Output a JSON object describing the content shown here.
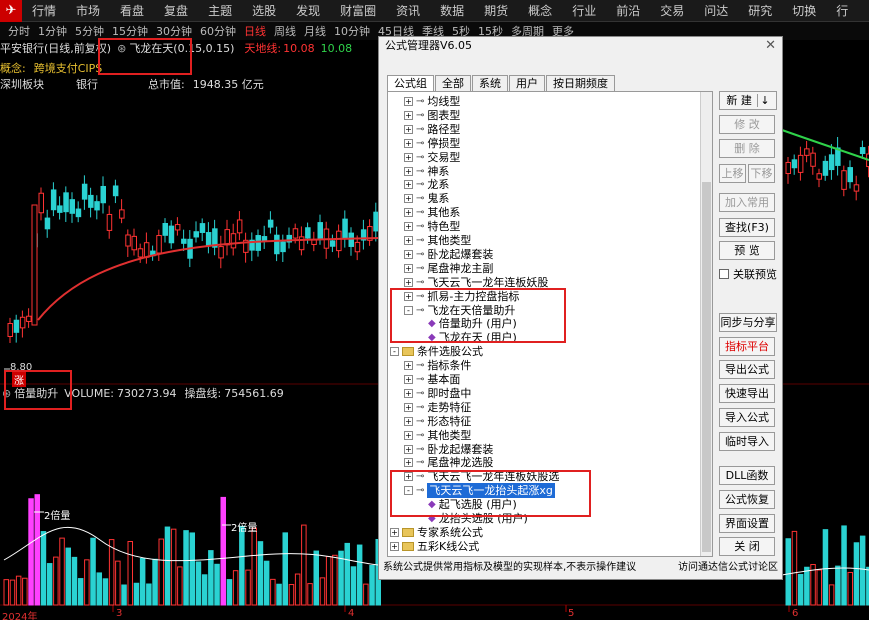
{
  "top_menu": [
    "行情",
    "市场",
    "看盘",
    "复盘",
    "主题",
    "选股",
    "发现",
    "财富圈",
    "资讯",
    "数据",
    "期货",
    "概念",
    "行业",
    "前沿",
    "交易",
    "问达",
    "研究",
    "切换",
    "行"
  ],
  "periods": [
    {
      "label": "分时",
      "active": false
    },
    {
      "label": "1分钟",
      "active": false
    },
    {
      "label": "5分钟",
      "active": false
    },
    {
      "label": "15分钟",
      "active": false
    },
    {
      "label": "30分钟",
      "active": false
    },
    {
      "label": "60分钟",
      "active": false
    },
    {
      "label": "日线",
      "active": true
    },
    {
      "label": "周线",
      "active": false
    },
    {
      "label": "月线",
      "active": false
    },
    {
      "label": "10分钟",
      "active": false
    },
    {
      "label": "45日线",
      "active": false
    },
    {
      "label": "季线",
      "active": false
    },
    {
      "label": "5秒",
      "active": false
    },
    {
      "label": "15秒",
      "active": false
    },
    {
      "label": "多周期",
      "active": false
    },
    {
      "label": "更多",
      "active": false
    }
  ],
  "stock": {
    "name_line": "平安银行(日线,前复权)",
    "indicator": "飞龙在天(0.15,0.15)",
    "tiandi_label": "天地线:",
    "tiandi_v1": "10.08",
    "tiandi_v2": "10.08",
    "concept_label": "概念:",
    "concept_value": "跨境支付CIPS",
    "board_label": "深圳板块",
    "industry": "银行",
    "mktcap_label": "总市值:",
    "mktcap_value": "1948.35 亿元",
    "price_low": "8.80",
    "zhang_label": "涨",
    "vol_indicator": "倍量助升",
    "vol_label": "VOLUME:",
    "vol_value": "730273.94",
    "cpx_label": "操盘线:",
    "cpx_value": "754561.69",
    "double_vol_1": "2倍量",
    "double_vol_2": "2倍量",
    "axis_dates": [
      "2024年",
      "3",
      "4",
      "5",
      "6"
    ]
  },
  "dialog": {
    "title": "公式管理器V6.05",
    "tabs": [
      "公式组",
      "全部",
      "系统",
      "用户",
      "按日期频度"
    ],
    "active_tab": 0,
    "tree": [
      {
        "label": "均线型",
        "level": 2,
        "kind": "key",
        "expander": "+"
      },
      {
        "label": "图表型",
        "level": 2,
        "kind": "key",
        "expander": "+"
      },
      {
        "label": "路径型",
        "level": 2,
        "kind": "key",
        "expander": "+"
      },
      {
        "label": "停损型",
        "level": 2,
        "kind": "key",
        "expander": "+"
      },
      {
        "label": "交易型",
        "level": 2,
        "kind": "key",
        "expander": "+"
      },
      {
        "label": "神系",
        "level": 2,
        "kind": "key",
        "expander": "+"
      },
      {
        "label": "龙系",
        "level": 2,
        "kind": "key",
        "expander": "+"
      },
      {
        "label": "鬼系",
        "level": 2,
        "kind": "key",
        "expander": "+"
      },
      {
        "label": "其他系",
        "level": 2,
        "kind": "key",
        "expander": "+"
      },
      {
        "label": "特色型",
        "level": 2,
        "kind": "key",
        "expander": "+"
      },
      {
        "label": "其他类型",
        "level": 2,
        "kind": "key",
        "expander": "+"
      },
      {
        "label": "卧龙起爆套装",
        "level": 2,
        "kind": "key",
        "expander": "+"
      },
      {
        "label": "尾盘神龙主副",
        "level": 2,
        "kind": "key",
        "expander": "+"
      },
      {
        "label": "飞天云飞一龙年连板妖股",
        "level": 2,
        "kind": "key",
        "expander": "+"
      },
      {
        "label": "抓易-主力控盘指标",
        "level": 2,
        "kind": "key",
        "expander": "+"
      },
      {
        "label": "飞龙在天倍量助升",
        "level": 2,
        "kind": "key",
        "expander": "-"
      },
      {
        "label": "倍量助升  (用户)",
        "level": 3,
        "kind": "formula",
        "expander": ""
      },
      {
        "label": "飞龙在天  (用户)",
        "level": 3,
        "kind": "formula",
        "expander": ""
      },
      {
        "label": "条件选股公式",
        "level": 1,
        "kind": "folder",
        "expander": "-"
      },
      {
        "label": "指标条件",
        "level": 2,
        "kind": "key",
        "expander": "+"
      },
      {
        "label": "基本面",
        "level": 2,
        "kind": "key",
        "expander": "+"
      },
      {
        "label": "即时盘中",
        "level": 2,
        "kind": "key",
        "expander": "+"
      },
      {
        "label": "走势特征",
        "level": 2,
        "kind": "key",
        "expander": "+"
      },
      {
        "label": "形态特征",
        "level": 2,
        "kind": "key",
        "expander": "+"
      },
      {
        "label": "其他类型",
        "level": 2,
        "kind": "key",
        "expander": "+"
      },
      {
        "label": "卧龙起爆套装",
        "level": 2,
        "kind": "key",
        "expander": "+"
      },
      {
        "label": "尾盘神龙选股",
        "level": 2,
        "kind": "key",
        "expander": "+"
      },
      {
        "label": "飞天云飞一龙年连板妖股选",
        "level": 2,
        "kind": "key",
        "expander": "+"
      },
      {
        "label": "飞天云飞一龙抬头起涨xg",
        "level": 2,
        "kind": "key",
        "expander": "-",
        "selected": true
      },
      {
        "label": "起飞选股  (用户)",
        "level": 3,
        "kind": "formula",
        "expander": ""
      },
      {
        "label": "龙抬头选股  (用户)",
        "level": 3,
        "kind": "formula",
        "expander": ""
      },
      {
        "label": "专家系统公式",
        "level": 1,
        "kind": "folder",
        "expander": "+"
      },
      {
        "label": "五彩K线公式",
        "level": 1,
        "kind": "folder",
        "expander": "+"
      }
    ],
    "buttons": {
      "new": "新  建",
      "modify": "修  改",
      "delete": "删  除",
      "move_up": "上移",
      "move_down": "下移",
      "add_common": "加入常用",
      "find": "查找(F3)",
      "preview": "预  览",
      "linked_preview": "关联预览",
      "sync_share": "同步与分享",
      "indicator_platform": "指标平台",
      "export": "导出公式",
      "quick_export": "快速导出",
      "import": "导入公式",
      "temp_import": "临时导入",
      "dll": "DLL函数",
      "restore": "公式恢复",
      "ui_settings": "界面设置",
      "close": "关  闭"
    },
    "footer_left": "系统公式提供常用指标及模型的实现样本,不表示操作建议",
    "footer_right": "访问通达信公式讨论区"
  },
  "colors": {
    "up": "#ff3333",
    "down": "#2ad2d2",
    "ma_red": "#e03030",
    "ma_green": "#2fd24a",
    "vol_magenta": "#ff40ff",
    "highlight_box": "#e02020"
  }
}
